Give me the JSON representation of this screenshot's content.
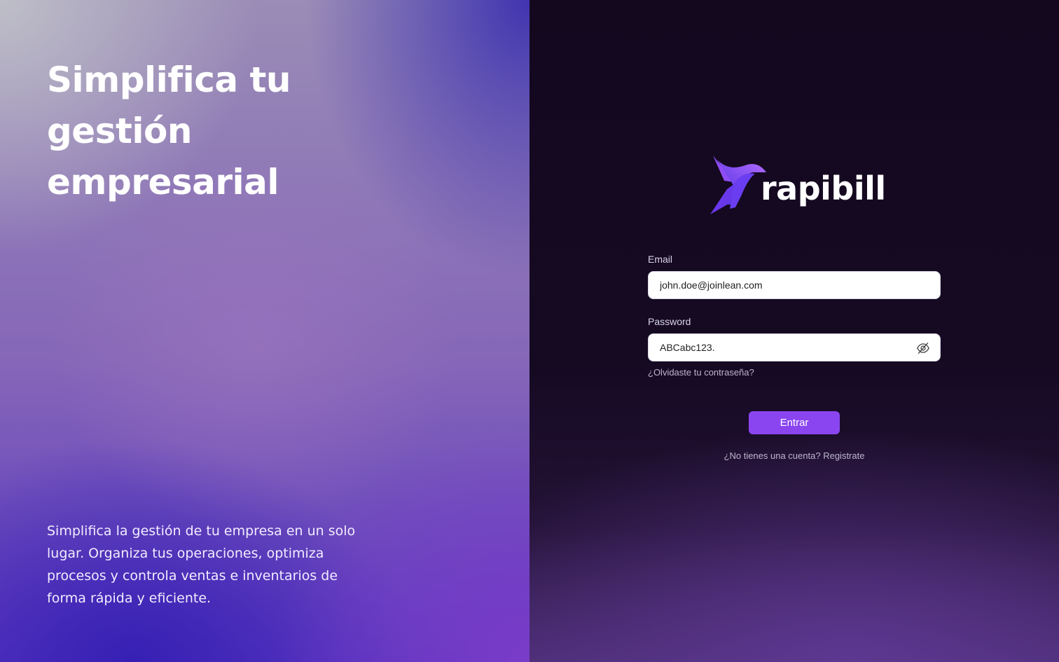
{
  "hero": {
    "title": "Simplifica tu gestión empresarial",
    "description": "Simplifica la gestión de tu empresa en un solo lugar. Organiza tus operaciones, optimiza procesos y controla ventas e inventarios de forma rápida y eficiente."
  },
  "brand": {
    "name": "rapibill",
    "logo_icon": "hummingbird-logo-icon",
    "accent_color": "#8a45f0"
  },
  "login": {
    "email_label": "Email",
    "email_value": "john.doe@joinlean.com",
    "password_label": "Password",
    "password_value": "ABCabc123.",
    "toggle_visibility_icon": "eye-slash-icon",
    "forgot_link": "¿Olvidaste tu contraseña?",
    "submit_label": "Entrar",
    "signup_prompt": "¿No tienes una cuenta?",
    "signup_link": "Registrate"
  }
}
